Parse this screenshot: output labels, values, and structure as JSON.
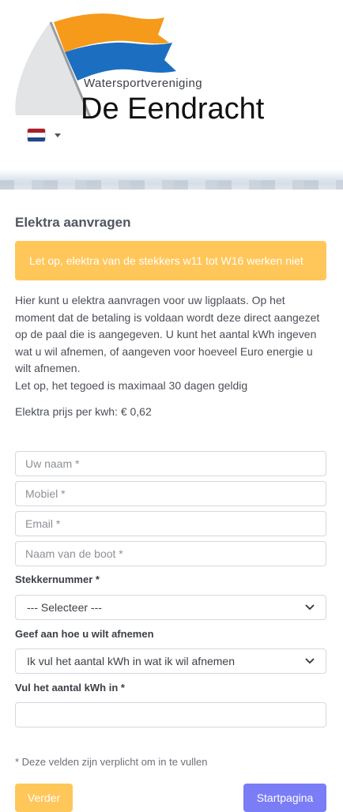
{
  "logo": {
    "subtitle": "Watersportvereniging",
    "name": "De Eendracht"
  },
  "language": {
    "current": "NL",
    "flag_colors": [
      "#ae1c28",
      "#ffffff",
      "#21468b"
    ]
  },
  "page": {
    "title": "Elektra aanvragen",
    "alert": "Let op, elektra van de stekkers w11 tot W16 werken niet",
    "intro_lines": [
      "Hier kunt u elektra aanvragen voor uw ligplaats. Op het moment dat de betaling is voldaan wordt deze direct aangezet op de paal die is aangegeven. U kunt het aantal kWh ingeven wat u wil afnemen, of aangeven voor hoeveel Euro energie u wilt afnemen.",
      "Let op, het tegoed is maximaal 30 dagen geldig"
    ],
    "price": "Elektra prijs per kwh: € 0,62"
  },
  "form": {
    "name_placeholder": "Uw naam *",
    "mobile_placeholder": "Mobiel *",
    "email_placeholder": "Email *",
    "boat_placeholder": "Naam van de boot *",
    "plug_label": "Stekkernummer *",
    "plug_value": "--- Selecteer ---",
    "mode_label": "Geef aan hoe u wilt afnemen",
    "mode_value": "Ik vul het aantal kWh in wat ik wil afnemen",
    "kwh_label": "Vul het aantal kWh in *",
    "kwh_value": "",
    "required_note": "* Deze velden zijn verplicht om in te vullen"
  },
  "buttons": {
    "next": "Verder",
    "home": "Startpagina"
  },
  "colors": {
    "accent": "#ffc65a",
    "home_button": "#7a7df5",
    "flag_orange": "#f59a1b",
    "flag_blue": "#1c6fc0"
  }
}
